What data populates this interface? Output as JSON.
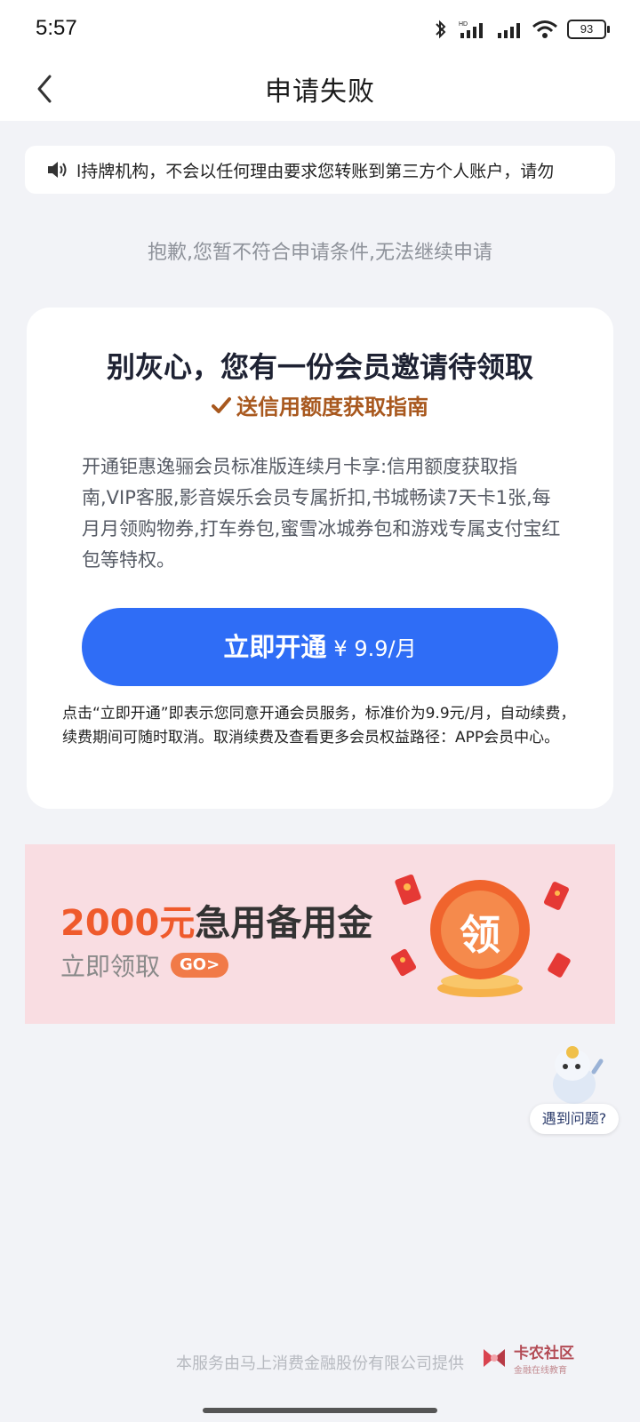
{
  "status_bar": {
    "time": "5:57",
    "battery": "93"
  },
  "nav": {
    "title": "申请失败"
  },
  "notice": {
    "text": "l持牌机构，不会以任何理由要求您转账到第三方个人账户，请勿"
  },
  "fail_message": "抱歉,您暂不符合申请条件,无法继续申请",
  "card": {
    "title": "别灰心，您有一份会员邀请待领取",
    "subtitle": "送信用额度获取指南",
    "description": "开通钜惠逸骊会员标准版连续月卡享:信用额度获取指南,VIP客服,影音娱乐会员专属折扣,书城畅读7天卡1张,每月月领购物券,打车券包,蜜雪冰城券包和游戏专属支付宝红包等特权。",
    "button_label": "立即开通",
    "button_price": "¥ 9.9/月",
    "agreement": "点击“立即开通”即表示您同意开通会员服务，标准价为9.9元/月，自动续费，续费期间可随时取消。取消续费及查看更多会员权益路径：APP会员中心。"
  },
  "promo": {
    "amount": "2000元",
    "title_rest": "急用备用金",
    "cta": "立即领取",
    "go": "GO>",
    "coin_text": "领"
  },
  "help": {
    "label": "遇到问题?"
  },
  "footer": {
    "text": "本服务由马上消费金融股份有限公司提供"
  },
  "watermark": {
    "title": "卡农社区",
    "sub": "金融在线教育"
  },
  "colors": {
    "primary_button": "#2f6df6",
    "subtitle_brown": "#a8581e",
    "promo_bg": "#f9dde2",
    "promo_orange": "#ef5a2c"
  }
}
